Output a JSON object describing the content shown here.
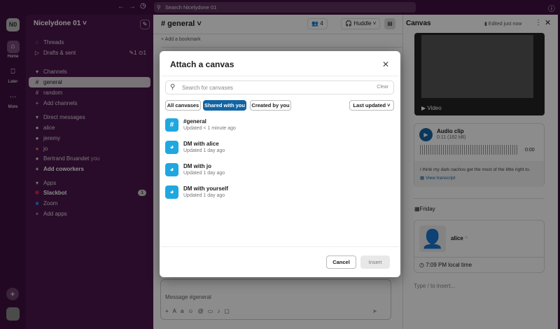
{
  "topbar": {
    "search_placeholder": "Search Nicelydone 01"
  },
  "rail": {
    "workspace_initials": "N0",
    "items": [
      {
        "label": "Home"
      },
      {
        "label": "Later"
      },
      {
        "label": "More"
      }
    ]
  },
  "sidebar": {
    "workspace": "Nicelydone 01",
    "threads": "Threads",
    "drafts": "Drafts & sent",
    "drafts_counts": "✎1 ⊙1",
    "channels_header": "Channels",
    "channels": [
      "general",
      "random"
    ],
    "add_channels": "Add channels",
    "dm_header": "Direct messages",
    "dms": [
      "alice",
      "jeremy",
      "jo",
      "Bertrand Bruandet"
    ],
    "you_label": "you",
    "add_coworkers": "Add coworkers",
    "apps_header": "Apps",
    "apps": [
      "Slackbot",
      "Zoom"
    ],
    "slackbot_badge": "1",
    "add_apps": "Add apps"
  },
  "channel": {
    "title": "# general",
    "member_count": "4",
    "huddle": "Huddle",
    "add_bookmark": "Add a bookmark",
    "composer_placeholder": "Message #general"
  },
  "canvas_panel": {
    "title": "Canvas",
    "edited": "Edited just now",
    "video_label": "Video",
    "audio_title": "Audio clip",
    "audio_meta": "0:11 (182 kB)",
    "audio_time": "0:00",
    "transcript_text": "I think my dark nachos get the most of the little right to.",
    "view_transcript": "View transcript",
    "day": "Friday",
    "user": "alice",
    "local_time": "7:09 PM local time",
    "insert_placeholder": "Type  /  to insert..."
  },
  "modal": {
    "title": "Attach a canvas",
    "search_placeholder": "Search for canvases",
    "clear": "Clear",
    "filters": [
      "All canvases",
      "Shared with you",
      "Created by you"
    ],
    "active_filter": 1,
    "sort": "Last updated",
    "items": [
      {
        "title": "#general",
        "subtitle": "Updated < 1 minute ago",
        "icon": "hash"
      },
      {
        "title": "DM with alice",
        "subtitle": "Updated 1 day ago",
        "icon": "dm"
      },
      {
        "title": "DM with jo",
        "subtitle": "Updated 1 day ago",
        "icon": "dm"
      },
      {
        "title": "DM with yourself",
        "subtitle": "Updated 1 day ago",
        "icon": "dm"
      }
    ],
    "cancel": "Cancel",
    "insert": "Insert"
  },
  "colors": {
    "primary": "#1264a3",
    "canvas_icon": "#1fa7e0",
    "aubergine": "#4a154b"
  }
}
